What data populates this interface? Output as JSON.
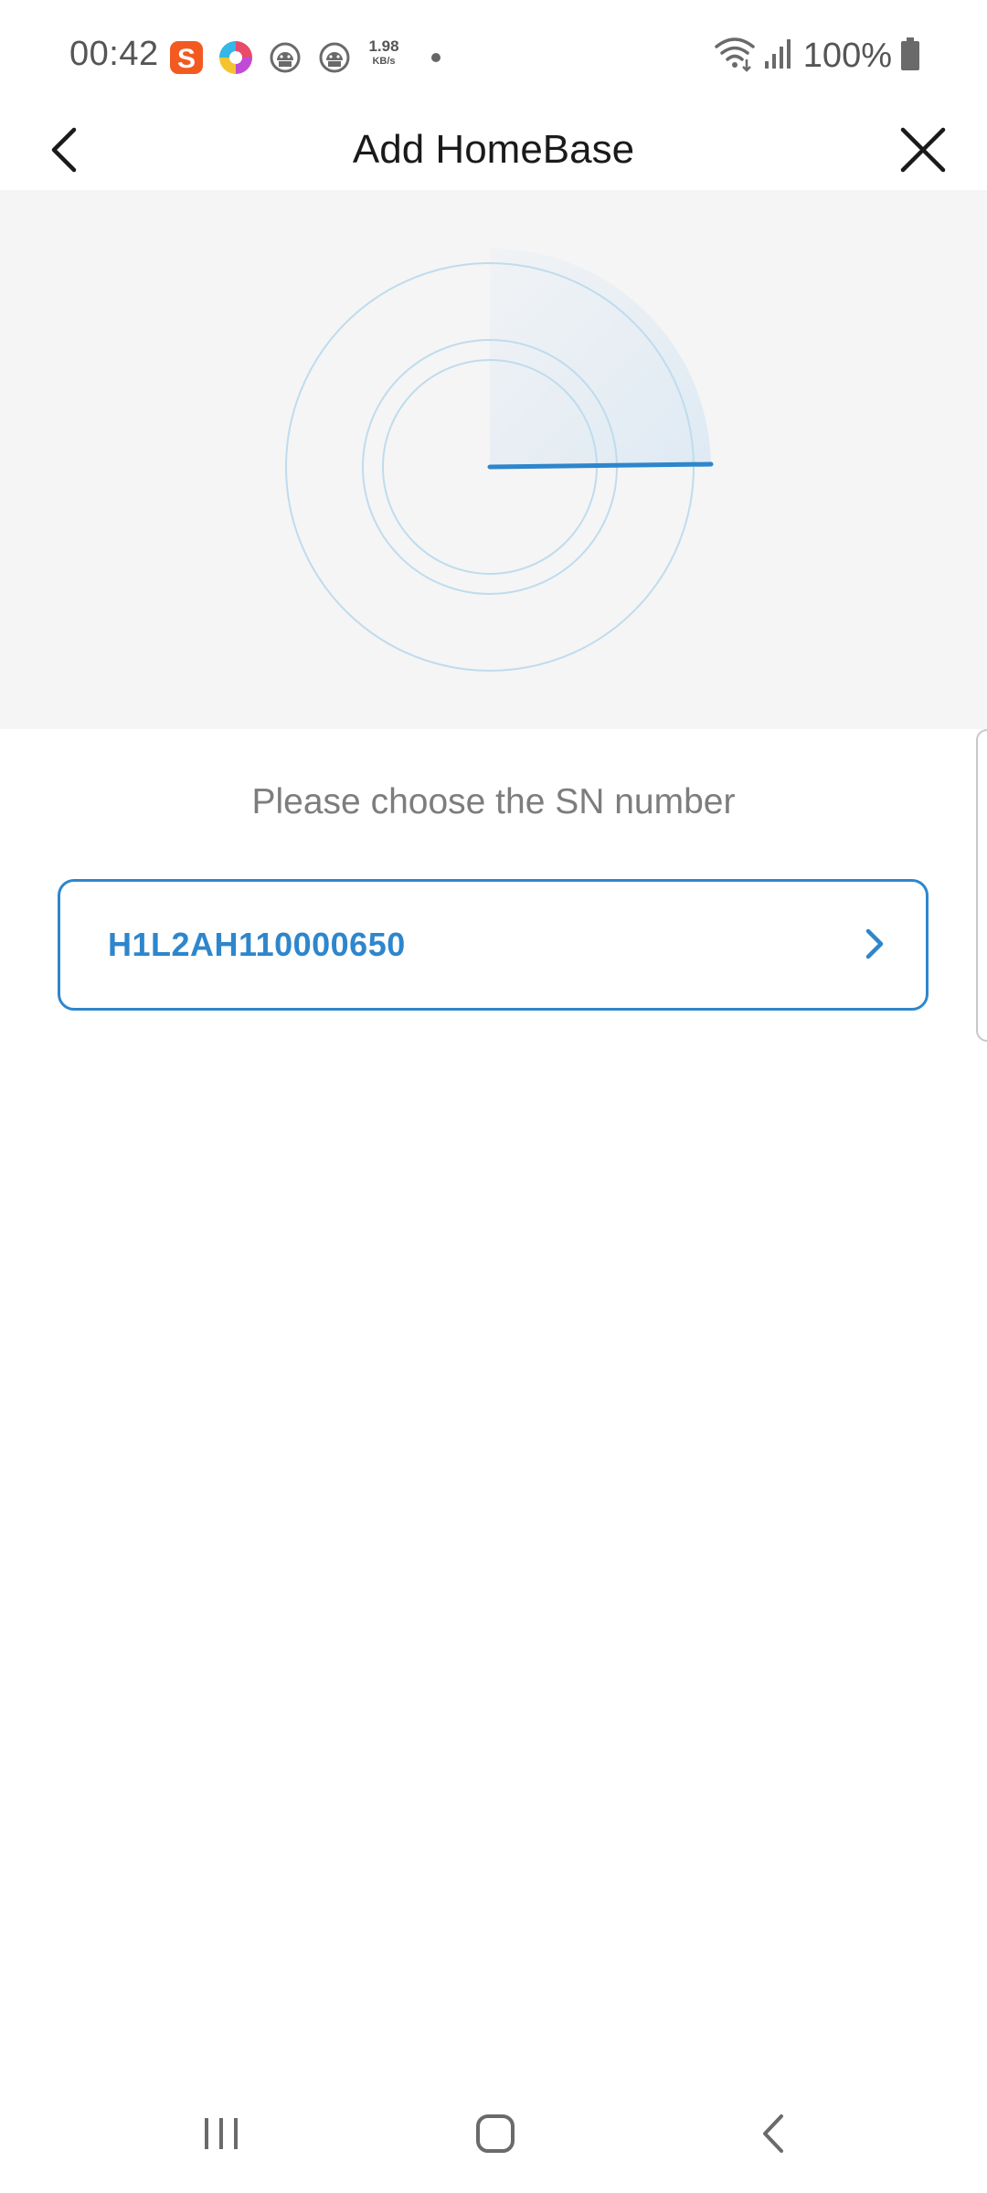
{
  "status_bar": {
    "time": "00:42",
    "net_speed_value": "1.98",
    "net_speed_unit": "KB/s",
    "battery_percent": "100%",
    "icons": [
      "sohu-app-icon",
      "colorful-app-icon",
      "android-head-icon",
      "android-head-icon",
      "wifi-icon",
      "signal-icon",
      "battery-icon"
    ]
  },
  "header": {
    "title": "Add HomeBase"
  },
  "main": {
    "prompt": "Please choose the SN number",
    "sn_items": [
      {
        "sn": "H1L2AH110000650"
      }
    ]
  },
  "colors": {
    "accent": "#2E86CC",
    "panel_bg": "#F5F5F5",
    "prompt_text": "#7D7D7D",
    "radar_line": "#BFDCEE"
  }
}
